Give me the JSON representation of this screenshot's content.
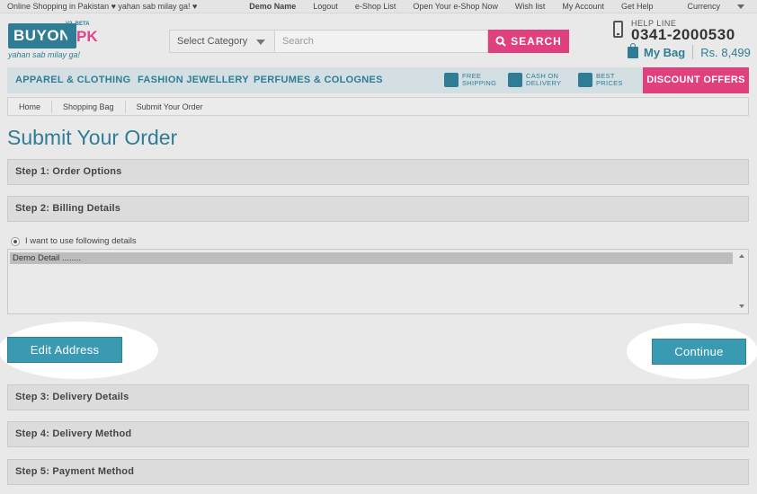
{
  "topbar": {
    "tagline": "Online Shopping in Pakistan ♥ yahan sab milay ga! ♥",
    "links": [
      "Demo Name",
      "Logout",
      "e-Shop List",
      "Open Your e-Shop Now",
      "Wish list",
      "My Account",
      "Get Help",
      "Currency"
    ]
  },
  "logo": {
    "brand": "BUYON",
    "suffix": "PK",
    "beta": "V2. BETA",
    "slogan": "yahan sab milay ga!"
  },
  "search": {
    "category": "Select Category",
    "placeholder": "Search",
    "button": "SEARCH"
  },
  "helpline": {
    "label": "HELP LINE",
    "number": "0341-2000530"
  },
  "bag": {
    "label": "My Bag",
    "amount": "Rs. 8,499"
  },
  "nav": {
    "items": [
      "APPAREL & CLOTHING",
      "FASHION JEWELLERY",
      "PERFUMES & COLOGNES"
    ],
    "features": [
      {
        "line1": "FREE",
        "line2": "SHIPPING",
        "icon": "truck-icon"
      },
      {
        "line1": "CASH ON",
        "line2": "DELIVERY",
        "icon": "cash-icon"
      },
      {
        "line1": "BEST",
        "line2": "PRICES",
        "icon": "price-tag-icon"
      }
    ],
    "discount": "DISCOUNT OFFERS"
  },
  "breadcrumb": [
    "Home",
    "Shopping Bag",
    "Submit Your Order"
  ],
  "page_title": "Submit Your Order",
  "steps": [
    "Step 1: Order Options",
    "Step 2: Billing Details",
    "Step 3: Delivery Details",
    "Step 4: Delivery Method",
    "Step 5: Payment Method"
  ],
  "billing": {
    "radio_label": "I want to use following details",
    "selected_address": "Demo Detail ........"
  },
  "buttons": {
    "edit_address": "Edit Address",
    "continue": "Continue"
  },
  "colors": {
    "accent": "#2e7d95",
    "pink": "#e0407e",
    "button": "#3a9ab2"
  }
}
